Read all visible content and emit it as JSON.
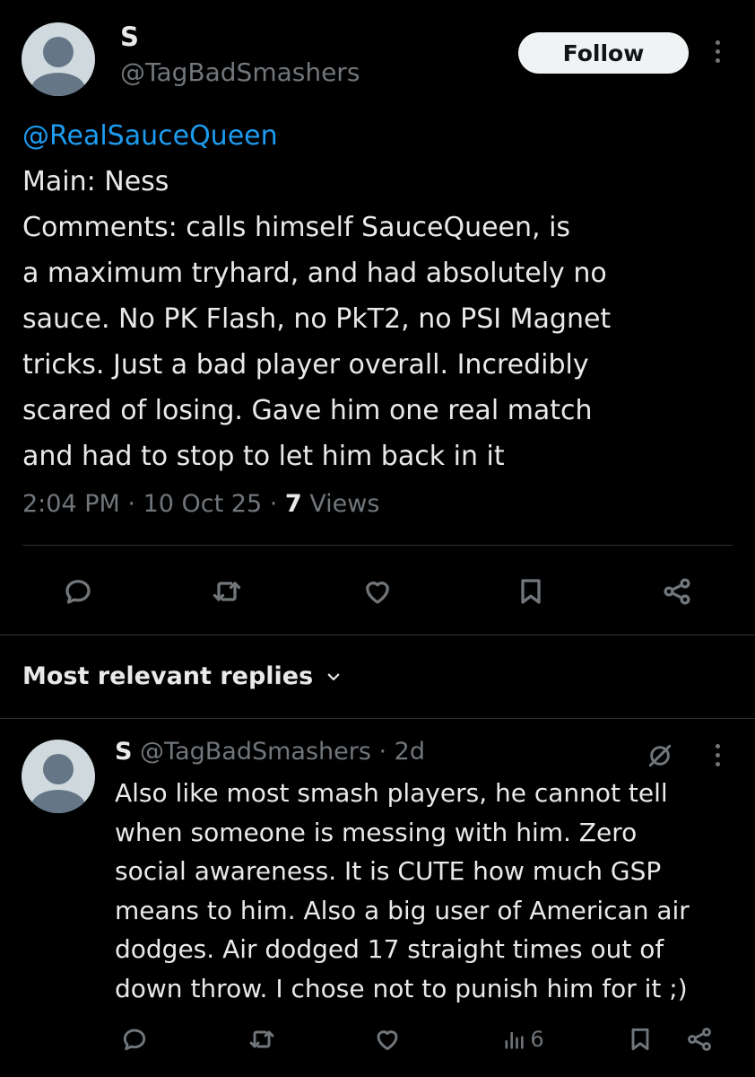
{
  "tweet": {
    "display_name": "S",
    "handle": "@TagBadSmashers",
    "follow_label": "Follow",
    "mention": "@RealSauceQueen",
    "lines": [
      "Main: Ness",
      "Comments: calls himself SauceQueen, is",
      "a maximum tryhard, and had absolutely no",
      "sauce. No PK Flash, no PkT2, no PSI Magnet",
      "tricks. Just a bad player overall. Incredibly",
      "scared of losing. Gave him one real match",
      "and had to stop to let him back in it"
    ],
    "time": "2:04 PM",
    "date": "10 Oct 25",
    "views_count": "7",
    "views_label": "Views"
  },
  "replies_section": {
    "title": "Most relevant replies"
  },
  "reply": {
    "display_name": "S",
    "handle": "@TagBadSmashers",
    "time_ago": "2d",
    "lines": [
      "Also like most smash players, he cannot tell",
      "when someone is messing with him. Zero",
      "social awareness. It is CUTE how much GSP",
      "means to him. Also a big user of American air",
      "dodges. Air dodged 17 straight times out of",
      "down throw. I chose not to punish him for it ;)"
    ],
    "views": "6"
  },
  "colors": {
    "background": "#000000",
    "text": "#e7e9ea",
    "muted": "#71767b",
    "accent": "#1d9bf0",
    "divider": "#2f3336"
  },
  "icons": [
    "reply-icon",
    "repost-icon",
    "like-icon",
    "bookmark-icon",
    "share-icon",
    "views-icon",
    "grok-icon",
    "more-icon",
    "chevron-down-icon"
  ]
}
